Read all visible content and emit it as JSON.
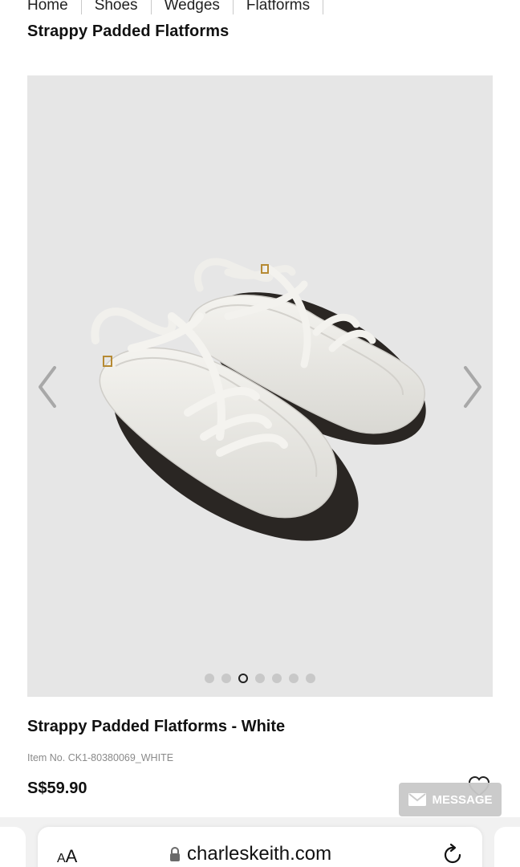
{
  "breadcrumb": [
    "Home",
    "Shoes",
    "Wedges",
    "Flatforms"
  ],
  "page_title": "Strappy Padded Flatforms",
  "gallery": {
    "slide_count": 7,
    "active_index": 2,
    "prev_icon": "chevron-left-icon",
    "next_icon": "chevron-right-icon"
  },
  "product": {
    "name": "Strappy Padded Flatforms - White",
    "item_no": "Item No. CK1-80380069_WHITE",
    "price": "S$59.90"
  },
  "message_button": {
    "label": "MESSAGE",
    "icon": "envelope-icon"
  },
  "browser": {
    "text_size_small": "A",
    "text_size_large": "A",
    "url": "charleskeith.com",
    "lock_icon": "lock-icon",
    "reload_icon": "reload-icon"
  },
  "colors": {
    "gallery_bg": "#e6e6e6",
    "message_bg": "#c9c9c9",
    "text": "#111111"
  }
}
